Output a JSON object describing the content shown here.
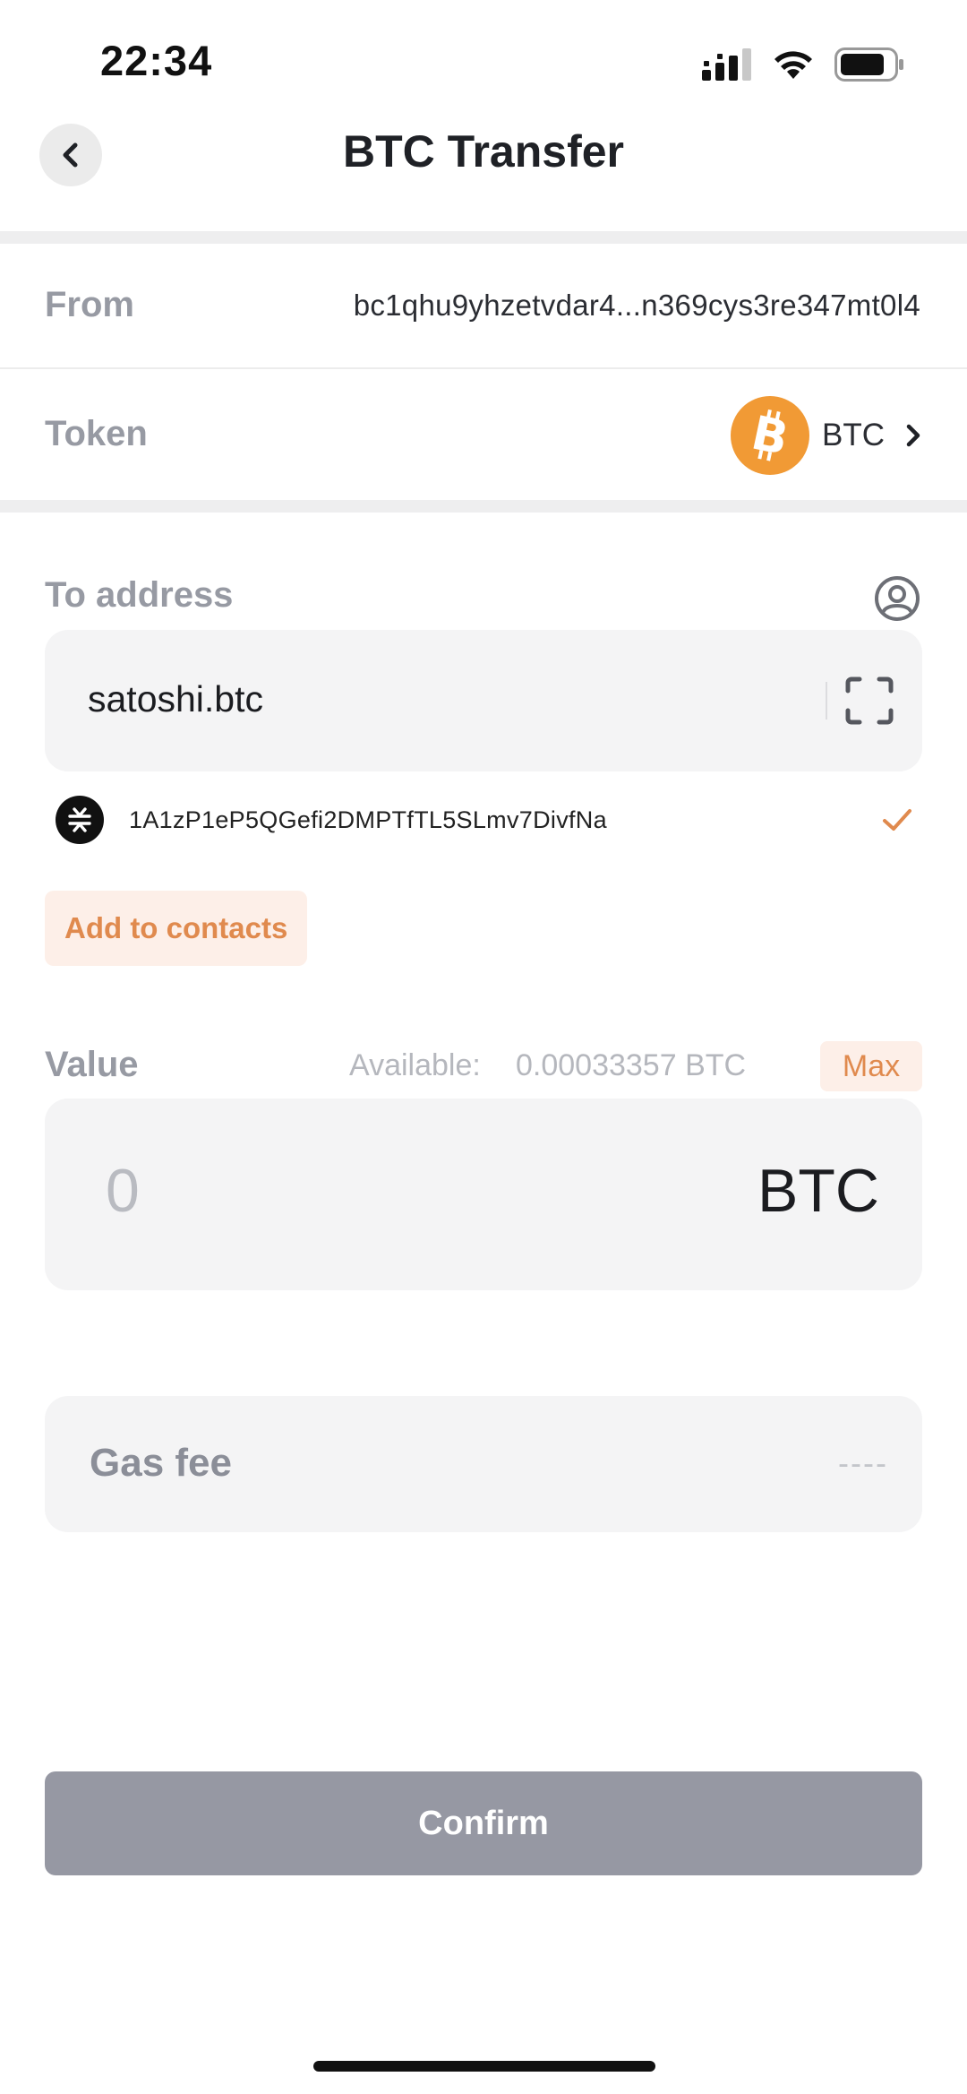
{
  "status_bar": {
    "time": "22:34",
    "icons": [
      "signal-icon",
      "wifi-icon",
      "battery-icon"
    ]
  },
  "nav": {
    "title": "BTC Transfer",
    "back_icon": "chevron-left-icon"
  },
  "from": {
    "label": "From",
    "value": "bc1qhu9yhzetvdar4...n369cys3re347mt0l4"
  },
  "token": {
    "label": "Token",
    "name": "BTC",
    "icon": "bitcoin-icon",
    "brand_color": "#f19a35"
  },
  "to_address": {
    "label": "To address",
    "value": "satoshi.btc",
    "resolved_address": "1A1zP1eP5QGefi2DMPTfTL5SLmv7DivfNa",
    "add_contacts_label": "Add to contacts"
  },
  "value": {
    "label": "Value",
    "available_label": "Available:",
    "available_amount": "0.00033357 BTC",
    "max_label": "Max",
    "input_placeholder": "0",
    "unit": "BTC"
  },
  "gas_fee": {
    "label": "Gas fee",
    "value": "----"
  },
  "confirm": {
    "label": "Confirm"
  },
  "colors": {
    "accent": "#e08a4e",
    "accent_bg": "#fdefe8",
    "disabled_button": "#9698a3"
  }
}
